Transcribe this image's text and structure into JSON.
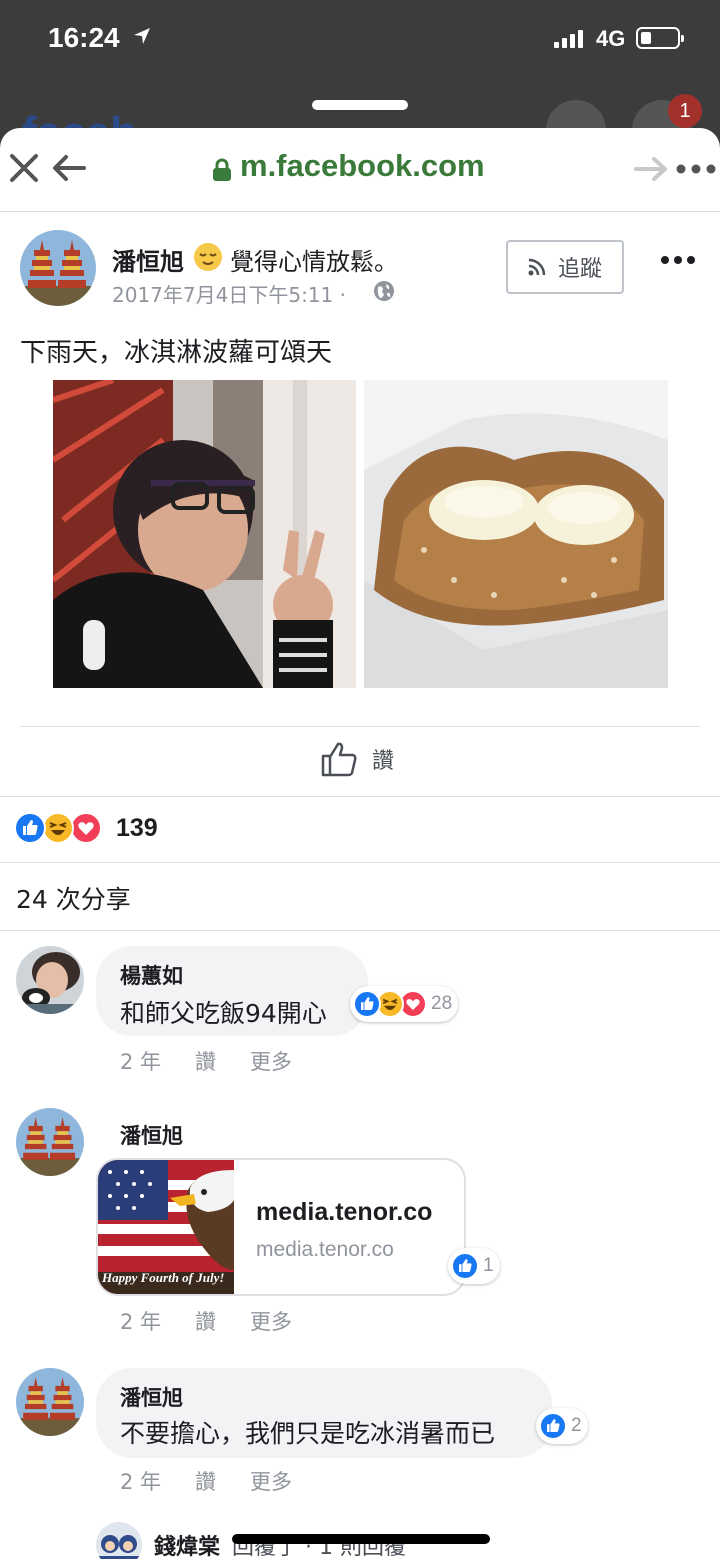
{
  "status_bar": {
    "time": "16:24",
    "network": "4G"
  },
  "background_page": {
    "brand_fragment": "faceb",
    "notification_count": "1"
  },
  "browser": {
    "host": "m.facebook.com"
  },
  "post": {
    "author": "潘恒旭",
    "feeling": "覺得心情放鬆。",
    "timestamp": "2017年7月4日下午5:11 ·",
    "follow_label": "追蹤",
    "text": "下雨天，冰淇淋波蘿可頌天",
    "like_label": "讚",
    "reaction_count": "139",
    "shares": "24 次分享"
  },
  "comments": [
    {
      "author": "楊蕙如",
      "text": "和師父吃飯94開心",
      "reaction_count": "28",
      "age": "2 年",
      "like_label": "讚",
      "more_label": "更多"
    },
    {
      "author": "潘恒旭",
      "link_title": "media.tenor.co",
      "link_host": "media.tenor.co",
      "thumb_caption": "Happy Fourth of July!",
      "reaction_count": "1",
      "age": "2 年",
      "like_label": "讚",
      "more_label": "更多"
    },
    {
      "author": "潘恒旭",
      "text": "不要擔心，我們只是吃冰消暑而已",
      "reaction_count": "2",
      "age": "2 年",
      "like_label": "讚",
      "more_label": "更多"
    }
  ],
  "reply_preview": {
    "author": "錢煒棠",
    "text": "回覆了 · 1 則回覆"
  },
  "colors": {
    "link_green": "#3a7a3a",
    "like_blue": "#1877f2",
    "haha_yellow": "#f7b928",
    "love_red": "#f33e58",
    "meta_gray": "#90949c"
  }
}
